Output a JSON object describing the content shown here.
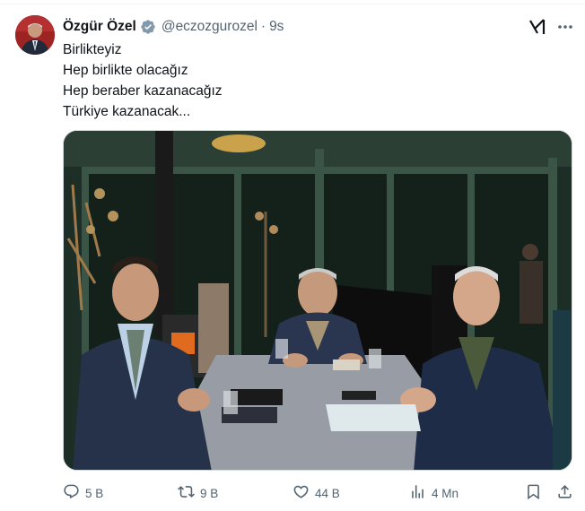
{
  "author": {
    "name": "Özgür Özel",
    "handle": "@eczozgurozel",
    "separator": "·",
    "time": "9s"
  },
  "tweet": {
    "lines": [
      "Birlikteyiz",
      "Hep birlikte olacağız",
      "Hep beraber kazanacağız",
      "Türkiye kazanacak..."
    ]
  },
  "icons": {
    "verified": "verified-badge-icon",
    "grok": "grok-icon",
    "more": "more-dots-icon",
    "reply": "reply-icon",
    "retweet": "retweet-icon",
    "like": "heart-icon",
    "views": "views-bar-icon",
    "bookmark": "bookmark-icon",
    "share": "share-icon"
  },
  "actions": {
    "reply_count": "5 B",
    "retweet_count": "9 B",
    "like_count": "44 B",
    "views_count": "4 Mn"
  },
  "colors": {
    "text": "#0f1419",
    "muted": "#536471",
    "verified": "#829aab",
    "border": "#cfd9de"
  }
}
